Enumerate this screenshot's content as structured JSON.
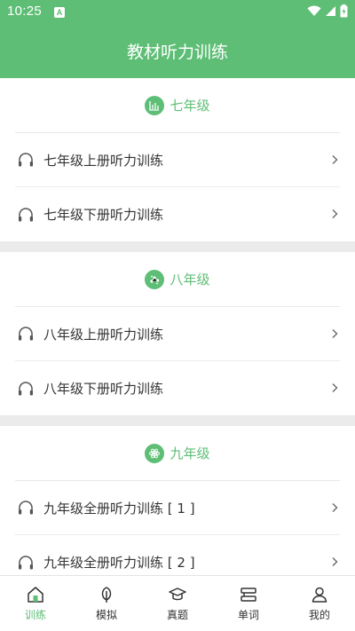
{
  "status": {
    "time": "10:25",
    "notification_badge": "A"
  },
  "header": {
    "title": "教材听力训练"
  },
  "sections": [
    {
      "title": "七年级",
      "items": [
        {
          "label": "七年级上册听力训练"
        },
        {
          "label": "七年级下册听力训练"
        }
      ]
    },
    {
      "title": "八年级",
      "items": [
        {
          "label": "八年级上册听力训练"
        },
        {
          "label": "八年级下册听力训练"
        }
      ]
    },
    {
      "title": "九年级",
      "items": [
        {
          "label": "九年级全册听力训练 [ 1 ]"
        },
        {
          "label": "九年级全册听力训练 [ 2 ]"
        }
      ]
    }
  ],
  "tabs": [
    {
      "label": "训练",
      "icon": "home-icon",
      "active": true
    },
    {
      "label": "模拟",
      "icon": "leaf-icon",
      "active": false
    },
    {
      "label": "真题",
      "icon": "graduation-cap-icon",
      "active": false
    },
    {
      "label": "单词",
      "icon": "card-icon",
      "active": false
    },
    {
      "label": "我的",
      "icon": "user-icon",
      "active": false
    }
  ],
  "colors": {
    "accent": "#5ebe76",
    "text": "#333333",
    "divider": "#ebebeb"
  }
}
